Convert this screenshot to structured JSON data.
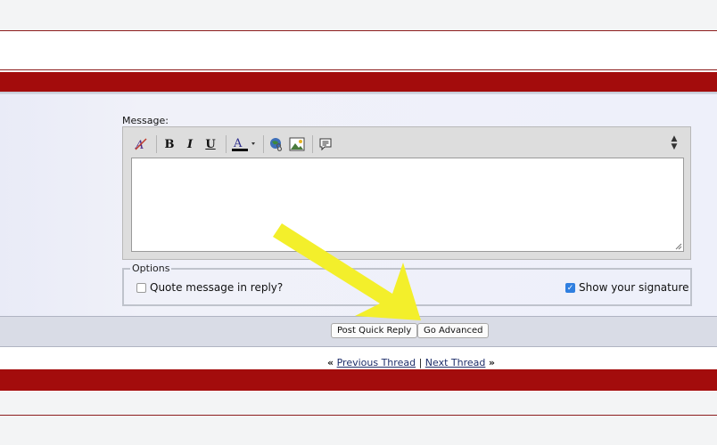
{
  "message": {
    "label": "Message:"
  },
  "toolbar": {
    "items": [
      {
        "name": "remove-format-icon",
        "glyph": "A̸"
      },
      {
        "name": "bold-icon",
        "glyph": "B"
      },
      {
        "name": "italic-icon",
        "glyph": "I"
      },
      {
        "name": "underline-icon",
        "glyph": "U"
      },
      {
        "name": "font-color-icon",
        "glyph": "A"
      },
      {
        "name": "insert-link-icon",
        "glyph": "🌐"
      },
      {
        "name": "insert-image-icon",
        "glyph": "🖼"
      },
      {
        "name": "quote-icon",
        "glyph": "≣"
      }
    ]
  },
  "options": {
    "legend": "Options",
    "quote_label": "Quote message in reply?",
    "quote_checked": false,
    "signature_label": "Show your signature",
    "signature_checked": true
  },
  "buttons": {
    "post_quick_reply": "Post Quick Reply",
    "go_advanced": "Go Advanced"
  },
  "nav": {
    "prev_arrows": "«",
    "previous_thread": "Previous Thread",
    "separator": "|",
    "next_thread": "Next Thread",
    "next_arrows": "»"
  },
  "colors": {
    "header_red": "#a30c0c",
    "panel_bg": "#eef0fa",
    "annotation_arrow": "#f3ef2b"
  }
}
